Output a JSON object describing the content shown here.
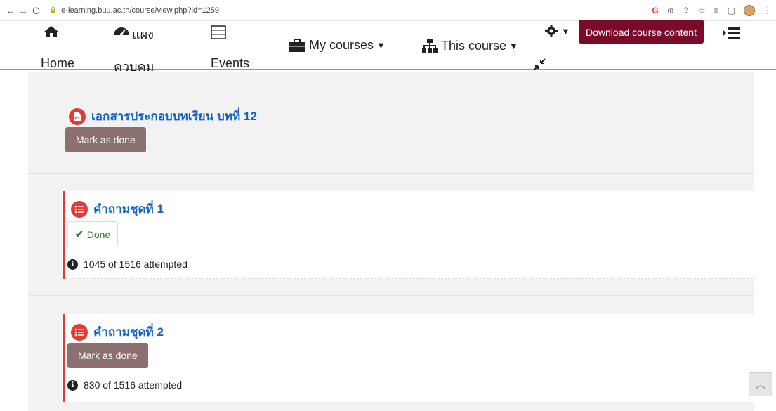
{
  "browser": {
    "url": "e-learning.buu.ac.th/course/view.php?id=1259",
    "back": "←",
    "forward": "→",
    "reload": "C"
  },
  "navbar": {
    "home": {
      "label": "Home",
      "icon": "home-icon"
    },
    "dashboard": {
      "label": "ควบคุม",
      "icon_label": "แผง",
      "icon": "dashboard-icon"
    },
    "events": {
      "label": "Events",
      "icon": "calendar-icon"
    },
    "my_courses": {
      "label": "My courses",
      "icon": "briefcase-icon"
    },
    "this_course": {
      "label": "This course",
      "icon": "sitemap-icon"
    },
    "download": "Download course content"
  },
  "sections": [
    {
      "title": "เอกสารประกอบบทเรียน บทที่ 12",
      "icon": "pdf-icon",
      "button": "Mark as done"
    },
    {
      "title": "คำถามชุดที่ 1",
      "icon": "quiz-icon",
      "button": "Done",
      "attempted": "1045 of 1516 attempted"
    },
    {
      "title": "คำถามชุดที่ 2",
      "icon": "quiz-icon",
      "button": "Mark as done",
      "attempted": "830 of 1516 attempted"
    }
  ],
  "colors": {
    "accent": "#e53935",
    "link": "#1565c0",
    "download_btn": "#7a0a2a",
    "mark_btn": "#8c7070"
  }
}
